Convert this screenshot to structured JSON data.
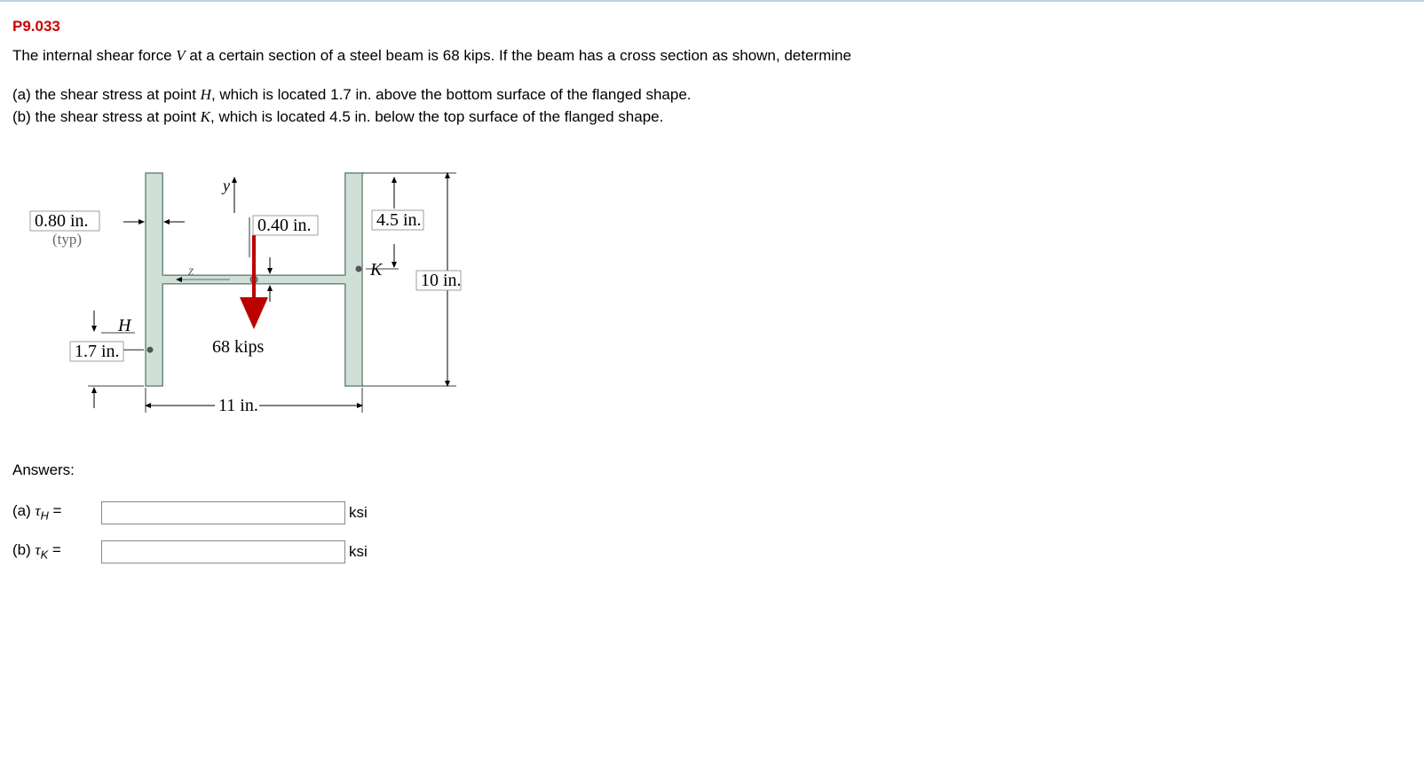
{
  "problem": {
    "number": "P9.033",
    "intro": "The internal shear force V at a certain section of a steel beam is 68 kips. If the beam has a cross section as shown, determine",
    "partA": "(a) the shear stress at point H, which is located 1.7 in. above the bottom surface of the flanged shape.",
    "partB": "(b) the shear stress at point K, which is located 4.5 in. below the top surface of the flanged shape."
  },
  "figure": {
    "flangeThickness": "0.80 in.",
    "flangeThicknessNote": "(typ)",
    "webThickness": "0.40 in.",
    "dimKDepth": "4.5 in.",
    "pointK": "K",
    "totalHeight": "10 in.",
    "pointH": "H",
    "dimHHeight": "1.7 in.",
    "shearForce": "68 kips",
    "width": "11 in.",
    "yLabel": "y",
    "zLabel": "z"
  },
  "answers": {
    "heading": "Answers:",
    "partA": {
      "prefix": "(a) ",
      "symbolSub": "H",
      "equals": " = ",
      "unit": "ksi"
    },
    "partB": {
      "prefix": "(b) ",
      "symbolSub": "K",
      "equals": " = ",
      "unit": "ksi"
    }
  }
}
